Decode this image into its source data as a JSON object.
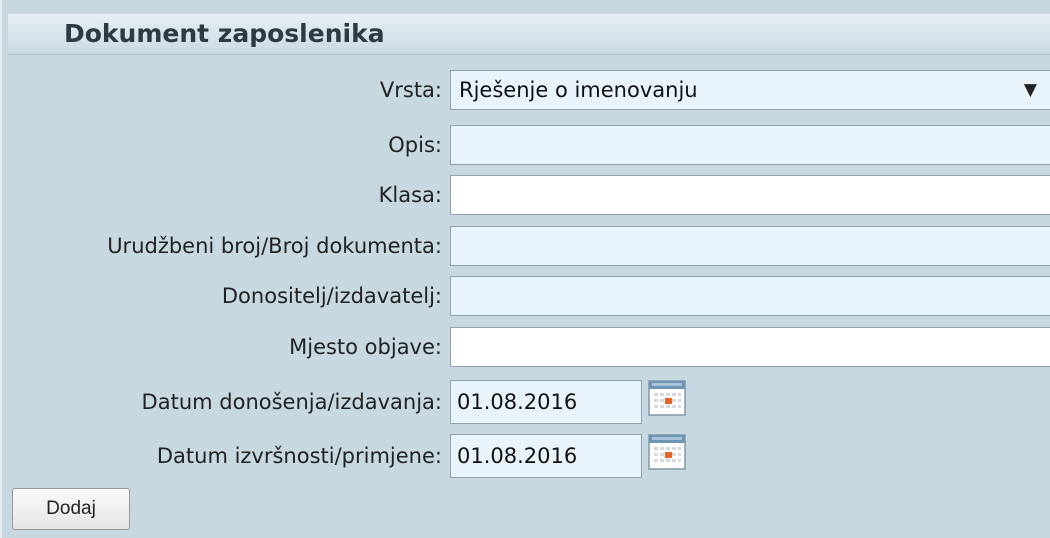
{
  "form": {
    "title": "Dokument zaposlenika",
    "fields": [
      {
        "label": "Vrsta:",
        "value": "Rješenje o imenovanju",
        "type": "select"
      },
      {
        "label": "Opis:",
        "value": "",
        "type": "text"
      },
      {
        "label": "Klasa:",
        "value": "",
        "type": "text"
      },
      {
        "label": "Urudžbeni broj/Broj dokumenta:",
        "value": "",
        "type": "text"
      },
      {
        "label": "Donositelj/izdavatelj:",
        "value": "",
        "type": "text"
      },
      {
        "label": "Mjesto objave:",
        "value": "",
        "type": "text"
      }
    ],
    "dates": [
      {
        "label": "Datum donošenja/izdavanja:",
        "value": "01.08.2016"
      },
      {
        "label": "Datum izvršnosti/primjene:",
        "value": "01.08.2016"
      }
    ],
    "add_button_label": "Dodaj"
  },
  "icons": {
    "select_arrow": "▼",
    "calendar": "calendar-icon"
  }
}
